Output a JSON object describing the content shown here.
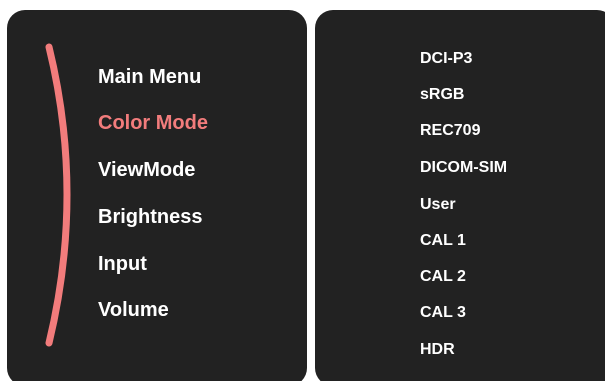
{
  "main_menu": {
    "items": [
      {
        "label": "Main Menu",
        "active": false
      },
      {
        "label": "Color Mode",
        "active": true
      },
      {
        "label": "ViewMode",
        "active": false
      },
      {
        "label": "Brightness",
        "active": false
      },
      {
        "label": "Input",
        "active": false
      },
      {
        "label": "Volume",
        "active": false
      }
    ]
  },
  "color_mode_options": {
    "items": [
      {
        "label": "DCI-P3"
      },
      {
        "label": "sRGB"
      },
      {
        "label": "REC709"
      },
      {
        "label": "DICOM-SIM"
      },
      {
        "label": "User"
      },
      {
        "label": "CAL 1"
      },
      {
        "label": "CAL 2"
      },
      {
        "label": "CAL 3"
      },
      {
        "label": "HDR"
      }
    ]
  },
  "colors": {
    "panel_bg": "#222222",
    "text": "#ffffff",
    "accent": "#f27c7c"
  }
}
